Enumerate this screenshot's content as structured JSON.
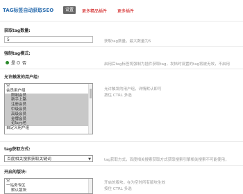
{
  "header": {
    "title": "TAG标签自动获取SEO",
    "tabs": [
      {
        "label": "设置",
        "active": true
      },
      {
        "label": "更多精品插件",
        "active": false
      },
      {
        "label": "更多插件",
        "active": false
      }
    ]
  },
  "fields": {
    "tag_count": {
      "label": "获取tag数量:",
      "value": "5",
      "hint": "获取tag数量，最大数量为5"
    },
    "mode": {
      "label": "强制tag模式:",
      "options": [
        {
          "label": "是",
          "checked": true
        },
        {
          "label": "否",
          "checked": false
        }
      ],
      "hint": "启用后tag标签将强制为插件获取tag，发帖时设置的tag将被无效，不启用"
    },
    "user_groups": {
      "label": "允许触发的用户组:",
      "options": [
        {
          "label": "空",
          "selected": false,
          "indent": false
        },
        {
          "label": "会员用户组",
          "selected": false,
          "indent": false
        },
        {
          "label": "限制会员",
          "selected": true,
          "indent": true
        },
        {
          "label": "新手上路",
          "selected": true,
          "indent": true
        },
        {
          "label": "注册会员",
          "selected": true,
          "indent": true
        },
        {
          "label": "中级会员",
          "selected": true,
          "indent": true
        },
        {
          "label": "高级会员",
          "selected": true,
          "indent": true
        },
        {
          "label": "金牌会员",
          "selected": true,
          "indent": true
        },
        {
          "label": "论坛元老",
          "selected": true,
          "indent": true
        },
        {
          "label": "自定义用户组",
          "selected": false,
          "indent": false
        }
      ],
      "hint1": "允许触发的用户组，详情默认即可",
      "hint2": "按住 CTRL 多选"
    },
    "method": {
      "label": "tag获取方式:",
      "value": "百度相关搜索获取关键词",
      "hint": "tag获取方式，百度相关搜索获取方式获取搜索引擎相关搜索不可能使用，"
    },
    "sections": {
      "label": "开启的版块:",
      "options": [
        {
          "label": "空",
          "selected": false,
          "indent": false
        },
        {
          "label": "一站务专区",
          "selected": false,
          "indent": false
        },
        {
          "label": "默认版块",
          "selected": false,
          "indent": true
        }
      ],
      "hint1": "开启的版块，在为空时所有版块生效",
      "hint2": "按住 CTRL 多选"
    }
  }
}
